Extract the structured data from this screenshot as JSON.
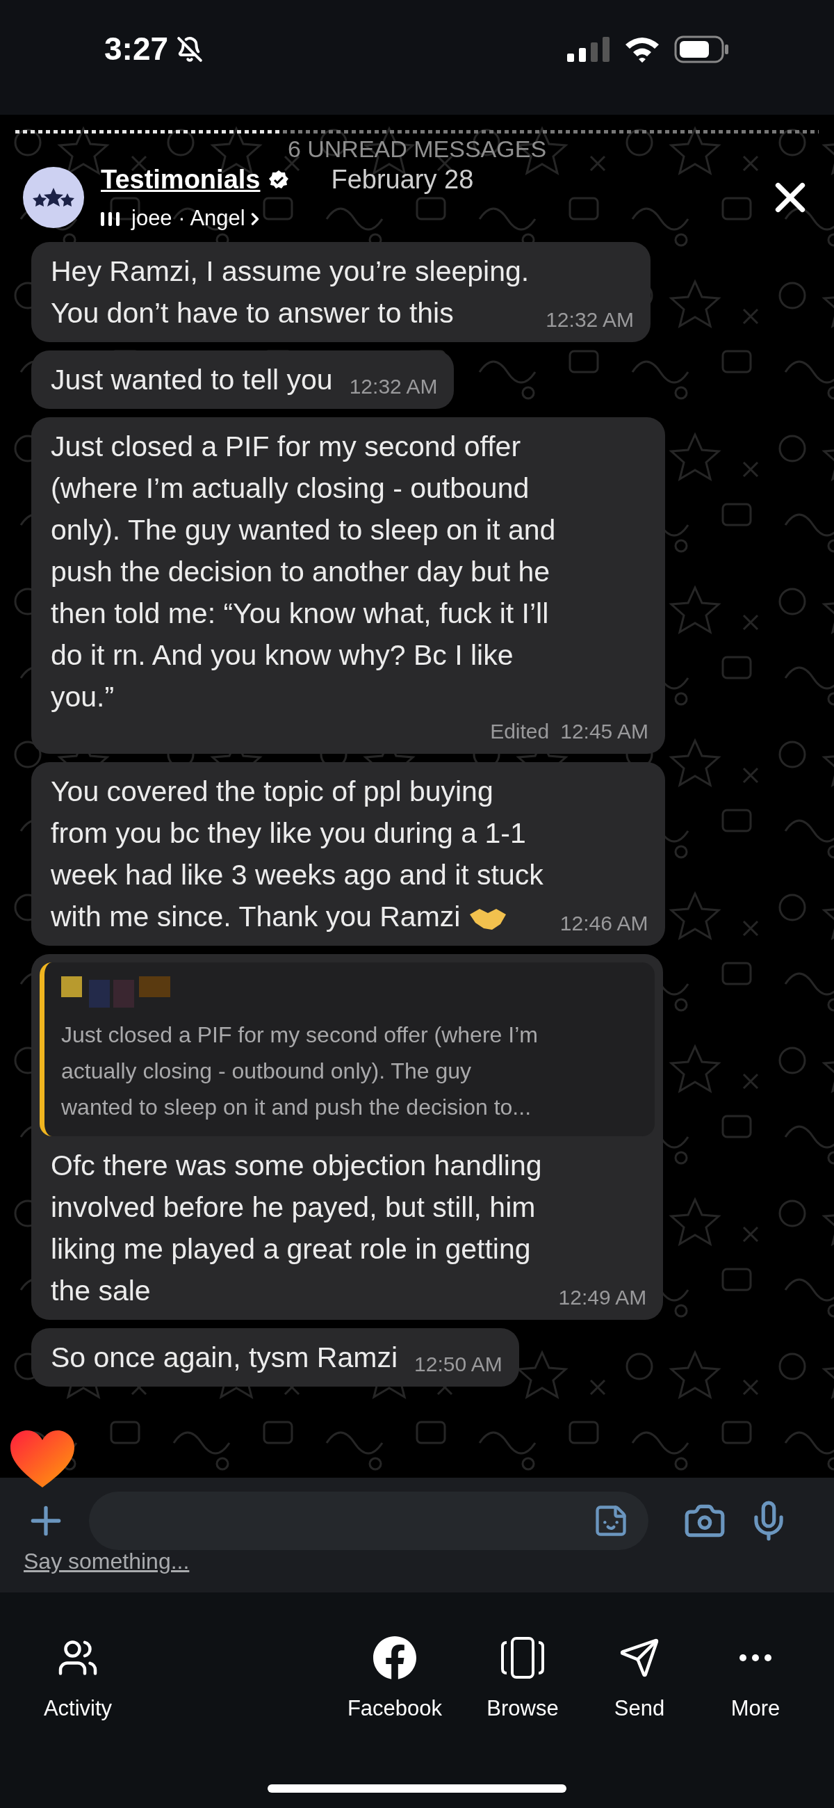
{
  "status_bar": {
    "time": "3:27"
  },
  "story": {
    "progress": {
      "level": 0.33
    },
    "overlay_text": "6 UNREAD MESSAGES",
    "account": "Testimonials",
    "verified": true,
    "date": "February 28",
    "music": "joee · Angel"
  },
  "messages": [
    {
      "lines": [
        "Hey Ramzi, I assume you’re sleeping.",
        "You don’t have to answer to this"
      ],
      "time": "12:32 AM"
    },
    {
      "lines": [
        "Just wanted to tell you"
      ],
      "time": "12:32 AM"
    },
    {
      "lines": [
        "Just closed a PIF for my second offer",
        "(where I’m actually closing - outbound",
        "only). The guy wanted to sleep on it and",
        "push the decision to another day but he",
        "then told me: “You know what, fuck it I’ll",
        "do it rn. And you know why? Bc I like",
        "you.”"
      ],
      "edited": "Edited",
      "time": "12:45 AM"
    },
    {
      "lines": [
        "You covered the topic of ppl buying",
        "from you bc they like you during a 1-1",
        "week had like 3 weeks ago and it stuck",
        "with me since. Thank you Ramzi"
      ],
      "time": "12:46 AM"
    },
    {
      "quote": {
        "lines": [
          "Just closed a PIF for my second offer (where I’m",
          "actually closing - outbound only). The guy",
          "wanted to sleep on it and push the decision to..."
        ]
      },
      "lines": [
        "Ofc there was some objection handling",
        "involved before he payed, but still, him",
        "liking me played a great role in getting",
        "the sale"
      ],
      "time": "12:49 AM"
    },
    {
      "lines": [
        "So once again, tysm Ramzi"
      ],
      "time": "12:50 AM"
    }
  ],
  "reply": {
    "caption": "Say something..."
  },
  "nav": [
    {
      "kind": "activity",
      "label": "Activity"
    },
    {
      "kind": "facebook",
      "label": "Facebook"
    },
    {
      "kind": "browse",
      "label": "Browse"
    },
    {
      "kind": "send",
      "label": "Send"
    },
    {
      "kind": "more",
      "label": "More"
    }
  ]
}
